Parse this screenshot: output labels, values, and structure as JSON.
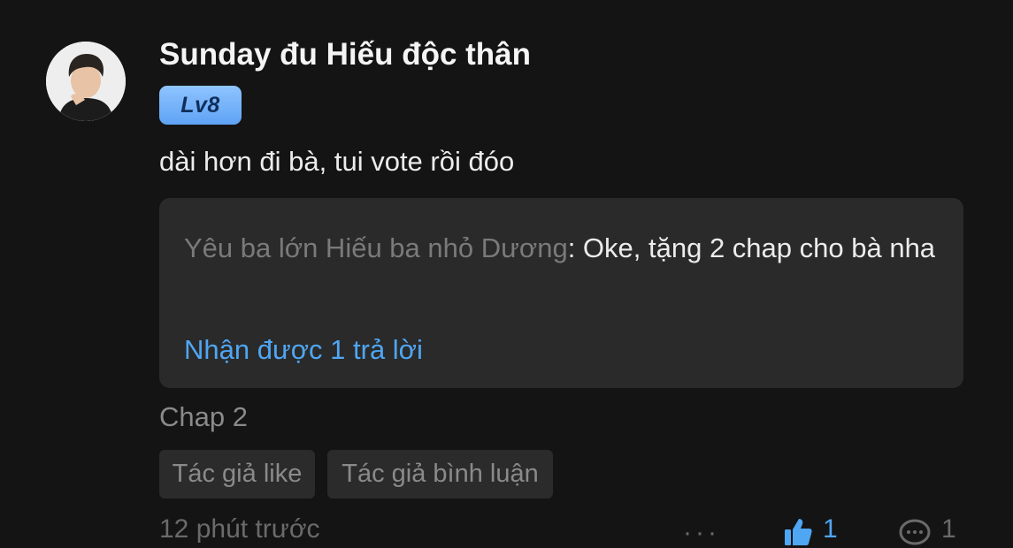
{
  "comment": {
    "username": "Sunday đu Hiếu độc thân",
    "level": "Lv8",
    "text": "dài hơn đi bà, tui vote rồi đóo",
    "reply": {
      "author": "Yêu ba lớn Hiếu ba nhỏ Dương",
      "separator": ":",
      "text": " Oke, tặng 2 chap cho bà nha",
      "count_label": "Nhận được 1 trả lời"
    },
    "chapter": "Chap 2",
    "tags": [
      "Tác giả like",
      "Tác giả bình luận"
    ],
    "footer": {
      "time": "12 phút trước",
      "more": "···",
      "like_count": "1",
      "reply_count": "1"
    }
  },
  "colors": {
    "background": "#141414",
    "reply_box": "#2a2a2a",
    "accent_blue": "#4fa6f3",
    "muted": "#8a8a8a",
    "badge": "#6fb0f8"
  },
  "icons": {
    "avatar": "user-avatar",
    "like": "thumbs-up-icon",
    "reply": "comment-bubble-icon"
  }
}
